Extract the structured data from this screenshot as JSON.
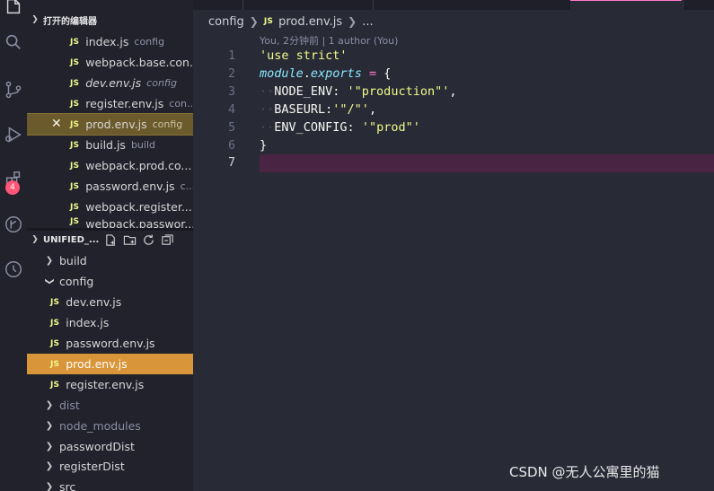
{
  "sidebar": {
    "open_editors": {
      "title": "打开的编辑器",
      "items": [
        {
          "name": "index.js",
          "desc": "config",
          "italic": false,
          "active": false
        },
        {
          "name": "webpack.base.con...",
          "desc": "",
          "italic": false,
          "active": false
        },
        {
          "name": "dev.env.js",
          "desc": "config",
          "italic": true,
          "active": false
        },
        {
          "name": "register.env.js",
          "desc": "con...",
          "italic": false,
          "active": false
        },
        {
          "name": "prod.env.js",
          "desc": "config",
          "italic": false,
          "active": true
        },
        {
          "name": "build.js",
          "desc": "build",
          "italic": false,
          "active": false
        },
        {
          "name": "webpack.prod.co...",
          "desc": "",
          "italic": false,
          "active": false
        },
        {
          "name": "password.env.js",
          "desc": "c...",
          "italic": false,
          "active": false
        },
        {
          "name": "webpack.register....",
          "desc": "",
          "italic": false,
          "active": false
        },
        {
          "name": "webpack.passwor...",
          "desc": "",
          "italic": false,
          "active": false
        }
      ]
    },
    "explorer": {
      "title": "UNIFIED_...",
      "folders": {
        "build": "build",
        "config": "config",
        "dist": "dist",
        "node_modules": "node_modules",
        "passwordDist": "passwordDist",
        "registerDist": "registerDist",
        "src": "src"
      },
      "config_files": [
        "dev.env.js",
        "index.js",
        "password.env.js",
        "prod.env.js",
        "register.env.js"
      ]
    },
    "js_badge": "JS",
    "close_glyph": "✕"
  },
  "activity": {
    "badge_count": "4"
  },
  "breadcrumb": {
    "folder": "config",
    "file": "prod.env.js",
    "more": "..."
  },
  "editor": {
    "codelens": "You, 2分钟前 | 1 author (You)",
    "line_numbers": [
      "1",
      "2",
      "3",
      "4",
      "5",
      "6",
      "7"
    ],
    "line1": {
      "str": "'use strict'"
    },
    "line2": {
      "kw1": "module",
      "dot": ".",
      "kw2": "exports",
      "eq": " = ",
      "brace": "{"
    },
    "line3": {
      "key": "NODE_ENV: ",
      "str": "'\"production\"'",
      "comma": ","
    },
    "line4": {
      "key": "BASEURL:",
      "str": "'\"/\"'",
      "comma": ","
    },
    "line5": {
      "key": "ENV_CONFIG: ",
      "str": "'\"prod\"'"
    },
    "line6": {
      "brace": "}"
    }
  },
  "watermark": "CSDN @无人公寓里的猫",
  "colors": {
    "accent": "#ff79c6",
    "selected": "#d9953a",
    "string": "#f1fa8c",
    "keyword": "#8be9fd"
  }
}
